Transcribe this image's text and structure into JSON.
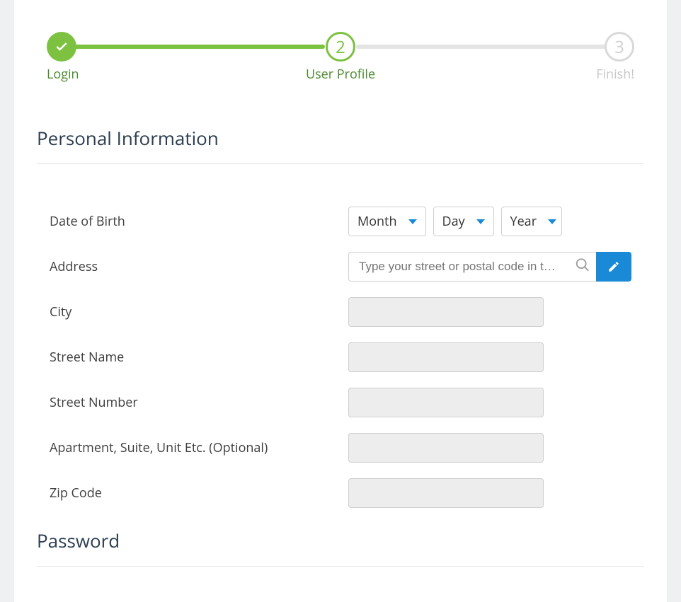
{
  "stepper": {
    "step1": {
      "label": "Login"
    },
    "step2": {
      "num": "2",
      "label": "User Profile"
    },
    "step3": {
      "num": "3",
      "label": "Finish!"
    }
  },
  "section": {
    "personal_info": "Personal Information",
    "password": "Password"
  },
  "labels": {
    "dob": "Date of Birth",
    "address": "Address",
    "city": "City",
    "street_name": "Street Name",
    "street_number": "Street Number",
    "apartment": "Apartment, Suite, Unit Etc. (Optional)",
    "zip": "Zip Code"
  },
  "dob": {
    "month": "Month",
    "day": "Day",
    "year": "Year"
  },
  "address": {
    "placeholder": "Type your street or postal code in t…"
  }
}
